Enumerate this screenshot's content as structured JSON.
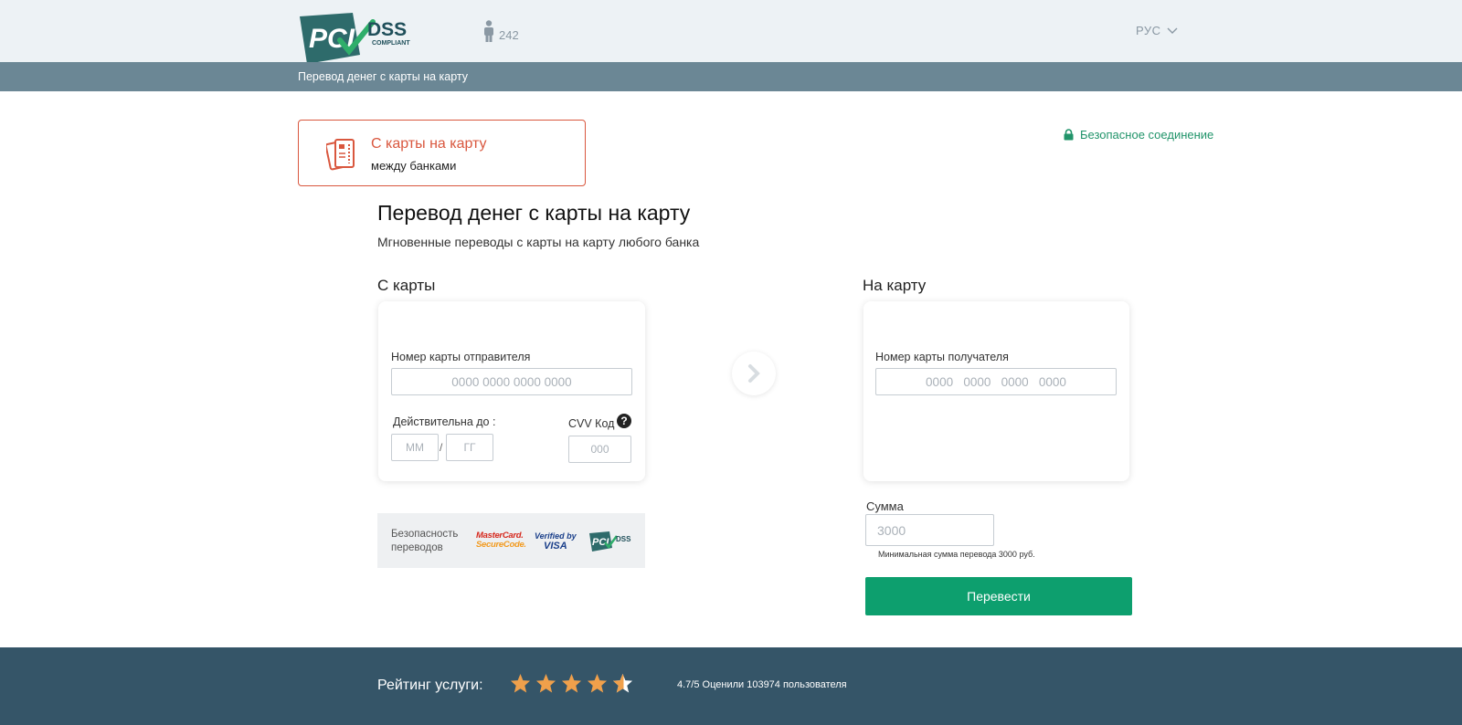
{
  "header": {
    "logo": {
      "pci": "PCI",
      "dss": "DSS",
      "compliant": "COMPLIANT"
    },
    "visitor_count": "242",
    "language": "РУС"
  },
  "subnav": {
    "breadcrumb": "Перевод денег с карты на карту"
  },
  "transfer_type": {
    "title": "С карты на карту",
    "subtitle": "между банками"
  },
  "secure_connection": "Безопасное соединение",
  "main": {
    "title": "Перевод денег с карты на карту",
    "subtitle": "Мгновенные переводы с карты на карту любого банка"
  },
  "from_card": {
    "section_title": "С карты",
    "card_number_label": "Номер карты отправителя",
    "card_number_placeholder": "0000 0000 0000 0000",
    "expiry_label": "Действительна до :",
    "month_placeholder": "ММ",
    "year_placeholder": "ГГ",
    "slash": "/",
    "cvv_label": "CVV Код",
    "cvv_placeholder": "000",
    "help": "?"
  },
  "to_card": {
    "section_title": "На карту",
    "card_number_label": "Номер карты получателя",
    "card_number_placeholder": "0000   0000   0000   0000"
  },
  "security": {
    "label": "Безопасность переводов",
    "badges": {
      "mastercard_1": "MasterCard.",
      "mastercard_2": "SecureCode.",
      "visa_1": "Verified by",
      "visa_2": "VISA",
      "pci": "PCI",
      "dss": "DSS"
    }
  },
  "amount": {
    "label": "Сумма",
    "placeholder": "3000",
    "min_note": "Минимальная сумма перевода 3000 руб."
  },
  "submit_label": "Перевести",
  "footer": {
    "rating_label": "Рейтинг услуги:",
    "rating": 4.7,
    "rating_text": "4.7/5 Оценили 103974 пользователя"
  },
  "colors": {
    "accent_green": "#0d9f6e",
    "accent_red": "#d9573e",
    "subnav": "#6b8795",
    "footer": "#355568",
    "star": "#f0a04b"
  }
}
